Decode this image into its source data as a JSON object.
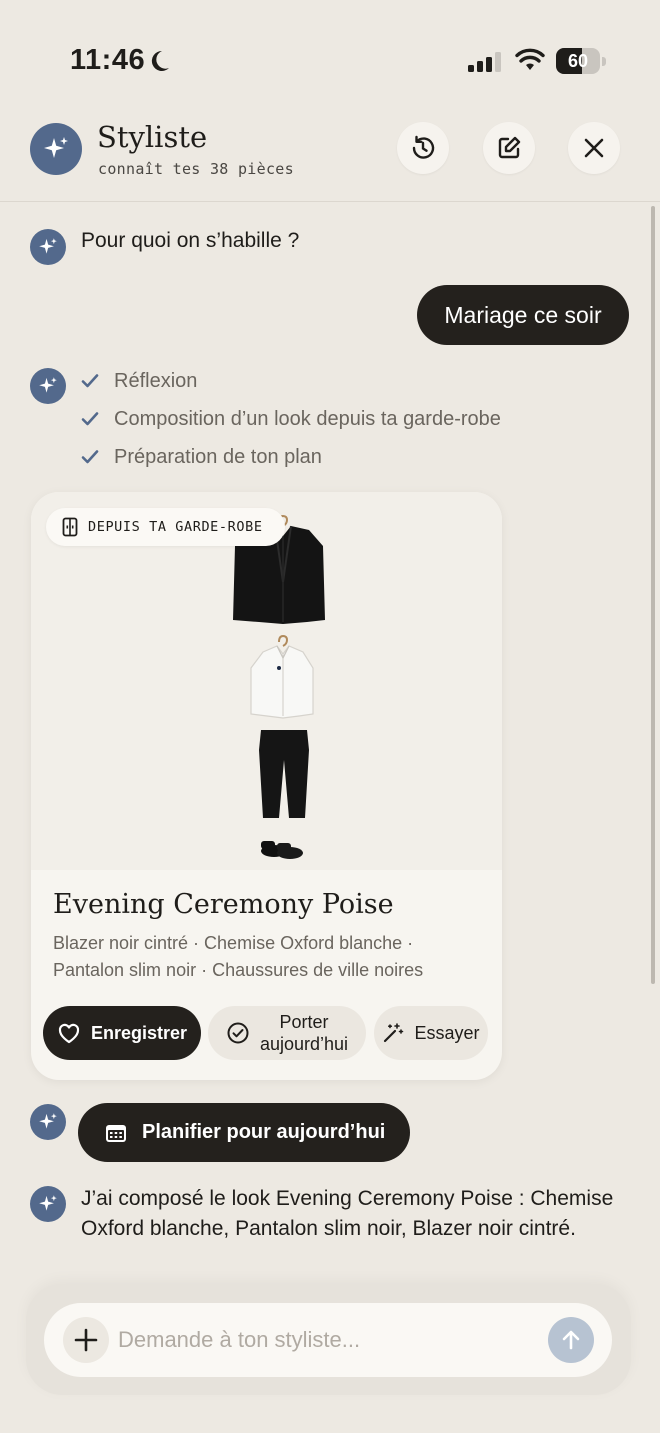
{
  "status_bar": {
    "time": "11:46",
    "battery": "60",
    "battery_level": 0.6
  },
  "header": {
    "title": "Styliste",
    "subtitle": "connaît tes 38 pièces",
    "icons": [
      "sparkle-icon",
      "history-icon",
      "edit-icon",
      "close-icon"
    ]
  },
  "chat": {
    "bot_question": "Pour quoi on s’habille ?",
    "user_message": "Mariage ce soir",
    "steps": [
      "Réflexion",
      "Composition d’un look depuis ta garde-robe",
      "Préparation de ton plan"
    ],
    "outfit_card": {
      "badge": "DEPUIS TA GARDE-ROBE",
      "title": "Evening Ceremony Poise",
      "description": "Blazer noir cintré · Chemise Oxford blanche · Pantalon slim noir · Chaussures de ville noires",
      "buttons": {
        "save": "Enregistrer",
        "wear_today_line1": "Porter",
        "wear_today_line2": "aujourd’hui",
        "try_on": "Essayer"
      }
    },
    "plan_button": "Planifier pour aujourd’hui",
    "final_message": "J’ai composé le look Evening Ceremony Poise : Chemise Oxford blanche, Pantalon slim noir, Blazer noir cintré."
  },
  "composer": {
    "placeholder": "Demande à ton styliste..."
  },
  "colors": {
    "background": "#ede9e2",
    "accent": "#53698c",
    "dark_button": "#24211d",
    "send_disabled": "#b7c3d2"
  }
}
